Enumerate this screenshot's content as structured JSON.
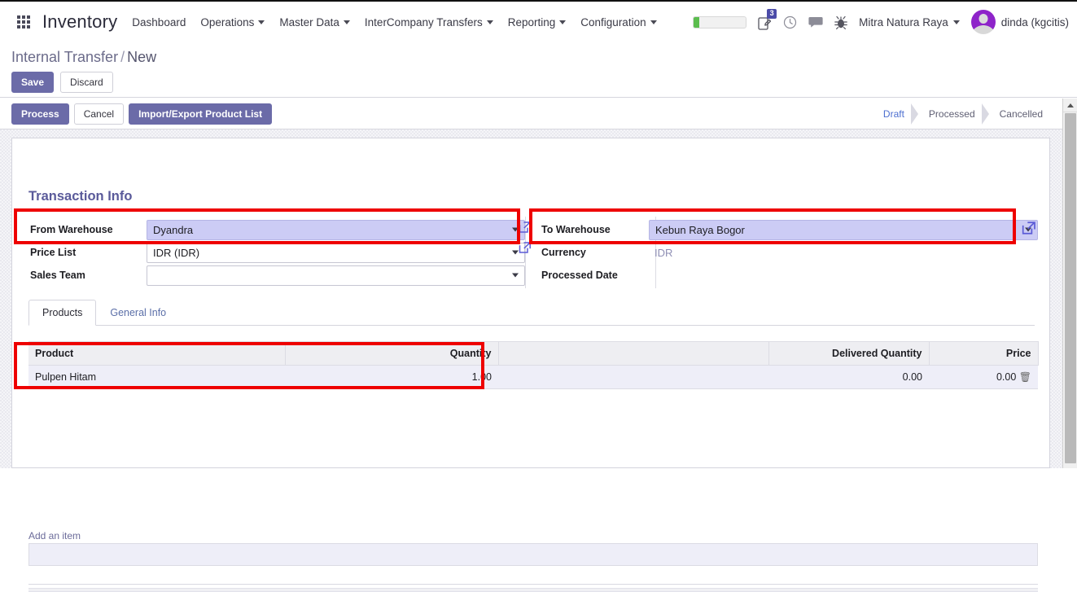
{
  "navbar": {
    "apps_icon": "apps-grid-icon",
    "brand": "Inventory",
    "menu": [
      {
        "label": "Dashboard",
        "has_caret": false
      },
      {
        "label": "Operations",
        "has_caret": true
      },
      {
        "label": "Master Data",
        "has_caret": true
      },
      {
        "label": "InterCompany Transfers",
        "has_caret": true
      },
      {
        "label": "Reporting",
        "has_caret": true
      },
      {
        "label": "Configuration",
        "has_caret": true
      }
    ],
    "progress_percent": 10,
    "progress_color": "#5bbd4e",
    "activity_badge": "3",
    "icons": [
      "note-edit-icon",
      "clock-icon",
      "chat-bubble-icon",
      "bug-icon"
    ],
    "company": "Mitra Natura Raya",
    "user": "dinda (kgcitis)",
    "avatar_color": "#8e24c9"
  },
  "breadcrumb": {
    "root": "Internal Transfer",
    "separator": "/",
    "current": "New"
  },
  "form_buttons": {
    "save": "Save",
    "discard": "Discard"
  },
  "action_bar": {
    "process": "Process",
    "cancel": "Cancel",
    "import_export": "Import/Export Product List",
    "status_steps": [
      {
        "label": "Draft",
        "active": true
      },
      {
        "label": "Processed",
        "active": false
      },
      {
        "label": "Cancelled",
        "active": false
      }
    ]
  },
  "form": {
    "section_title": "Transaction Info",
    "left": [
      {
        "label": "From Warehouse",
        "value": "Dyandra",
        "type": "select",
        "focused": true
      },
      {
        "label": "Price List",
        "value": "IDR (IDR)",
        "type": "select",
        "focused": false
      },
      {
        "label": "Sales Team",
        "value": "",
        "type": "select",
        "focused": false
      }
    ],
    "right": [
      {
        "label": "To Warehouse",
        "value": "Kebun Raya Bogor",
        "type": "select",
        "focused": true
      },
      {
        "label": "Currency",
        "value": "IDR",
        "type": "readonly"
      },
      {
        "label": "Processed Date",
        "value": "",
        "type": "readonly"
      }
    ]
  },
  "tabs": [
    {
      "label": "Products",
      "active": true
    },
    {
      "label": "General Info",
      "active": false
    }
  ],
  "lines_table": {
    "headers": [
      "Product",
      "Quantity",
      "",
      "Delivered Quantity",
      "Price"
    ],
    "rows": [
      {
        "product": "Pulpen Hitam",
        "quantity": "1.00",
        "spacer": "",
        "delivered_quantity": "0.00",
        "price": "0.00",
        "delete_icon": "trash-icon"
      }
    ],
    "add_item_label": "Add an item"
  },
  "annotations": {
    "color": "#ee0000",
    "boxes": [
      "from-warehouse-field",
      "to-warehouse-field",
      "product-line-quantity"
    ]
  }
}
